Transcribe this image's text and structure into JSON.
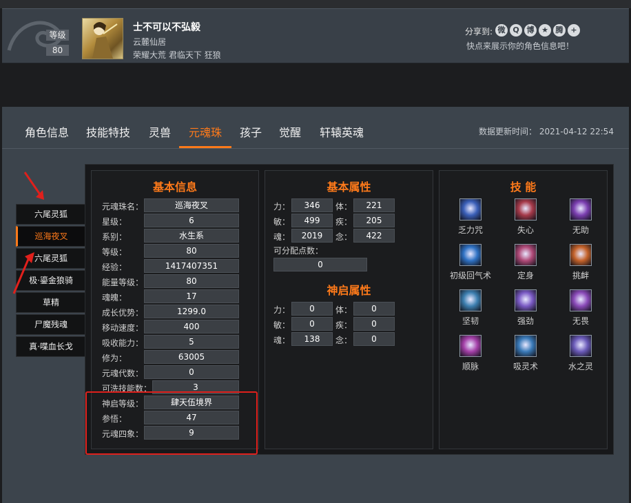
{
  "header": {
    "level_label": "等级",
    "level_value": "80",
    "name": "士不可以不弘毅",
    "server": "云麓仙居",
    "titles": "荣耀大荒 君临天下 狂狼",
    "share_label": "分享到:",
    "share_icons": [
      "wechat-icon",
      "qq-icon",
      "weibo-icon",
      "qzone-icon",
      "tencent-icon",
      "plus-icon"
    ],
    "share_tip": "快点来展示你的角色信息吧！"
  },
  "tabs": [
    "角色信息",
    "技能特技",
    "灵兽",
    "元魂珠",
    "孩子",
    "觉醒",
    "轩辕英魂"
  ],
  "active_tab": "元魂珠",
  "update_time": "数据更新时间： 2021-04-12 22:54",
  "sidebar": [
    "六尾灵狐",
    "巡海夜叉",
    "六尾灵狐",
    "极·鎏金狼骑",
    "草精",
    "尸魔残魂",
    "真·喋血长戈"
  ],
  "basic_info": {
    "title": "基本信息",
    "rows": [
      {
        "label": "元魂珠名：",
        "value": "巡海夜叉"
      },
      {
        "label": "星级：",
        "value": "6"
      },
      {
        "label": "系别：",
        "value": "水生系"
      },
      {
        "label": "等级：",
        "value": "80"
      },
      {
        "label": "经验：",
        "value": "1417407351"
      },
      {
        "label": "能量等级：",
        "value": "80"
      },
      {
        "label": "魂魄：",
        "value": "17"
      },
      {
        "label": "成长优势：",
        "value": "1299.0"
      },
      {
        "label": "移动速度：",
        "value": "400"
      },
      {
        "label": "吸收能力：",
        "value": "5"
      },
      {
        "label": "修为：",
        "value": "63005"
      },
      {
        "label": "元魂代数：",
        "value": "0"
      },
      {
        "label": "可洗技能数：",
        "value": "3"
      },
      {
        "label": "神启等级：",
        "value": "肆天伍境界"
      },
      {
        "label": "参悟：",
        "value": "47"
      },
      {
        "label": "元魂四象：",
        "value": "9"
      }
    ]
  },
  "basic_attr": {
    "title": "基本属性",
    "rows": [
      {
        "l1": "力：",
        "v1": "346",
        "l2": "体：",
        "v2": "221"
      },
      {
        "l1": "敏：",
        "v1": "499",
        "l2": "疾：",
        "v2": "205"
      },
      {
        "l1": "魂：",
        "v1": "2019",
        "l2": "念：",
        "v2": "422"
      }
    ],
    "points_label": "可分配点数：",
    "points_value": "0"
  },
  "shenqi_attr": {
    "title": "神启属性",
    "rows": [
      {
        "l1": "力：",
        "v1": "0",
        "l2": "体：",
        "v2": "0"
      },
      {
        "l1": "敏：",
        "v1": "0",
        "l2": "疾：",
        "v2": "0"
      },
      {
        "l1": "魂：",
        "v1": "138",
        "l2": "念：",
        "v2": "0"
      }
    ]
  },
  "skills": {
    "title": "技 能",
    "items": [
      {
        "name": "乏力咒",
        "color": "#3a5fb8"
      },
      {
        "name": "失心",
        "color": "#a63a4a"
      },
      {
        "name": "无助",
        "color": "#7b3fb0"
      },
      {
        "name": "初级回气术",
        "color": "#2f72c4"
      },
      {
        "name": "定身",
        "color": "#b04a78"
      },
      {
        "name": "挑衅",
        "color": "#c4622a"
      },
      {
        "name": "坚韧",
        "color": "#3d7fb0"
      },
      {
        "name": "强劲",
        "color": "#7a5ac4"
      },
      {
        "name": "无畏",
        "color": "#8a4ab8"
      },
      {
        "name": "顺脉",
        "color": "#a440a8"
      },
      {
        "name": "吸灵术",
        "color": "#3a7ab8"
      },
      {
        "name": "水之灵",
        "color": "#6a5ab8"
      }
    ]
  }
}
